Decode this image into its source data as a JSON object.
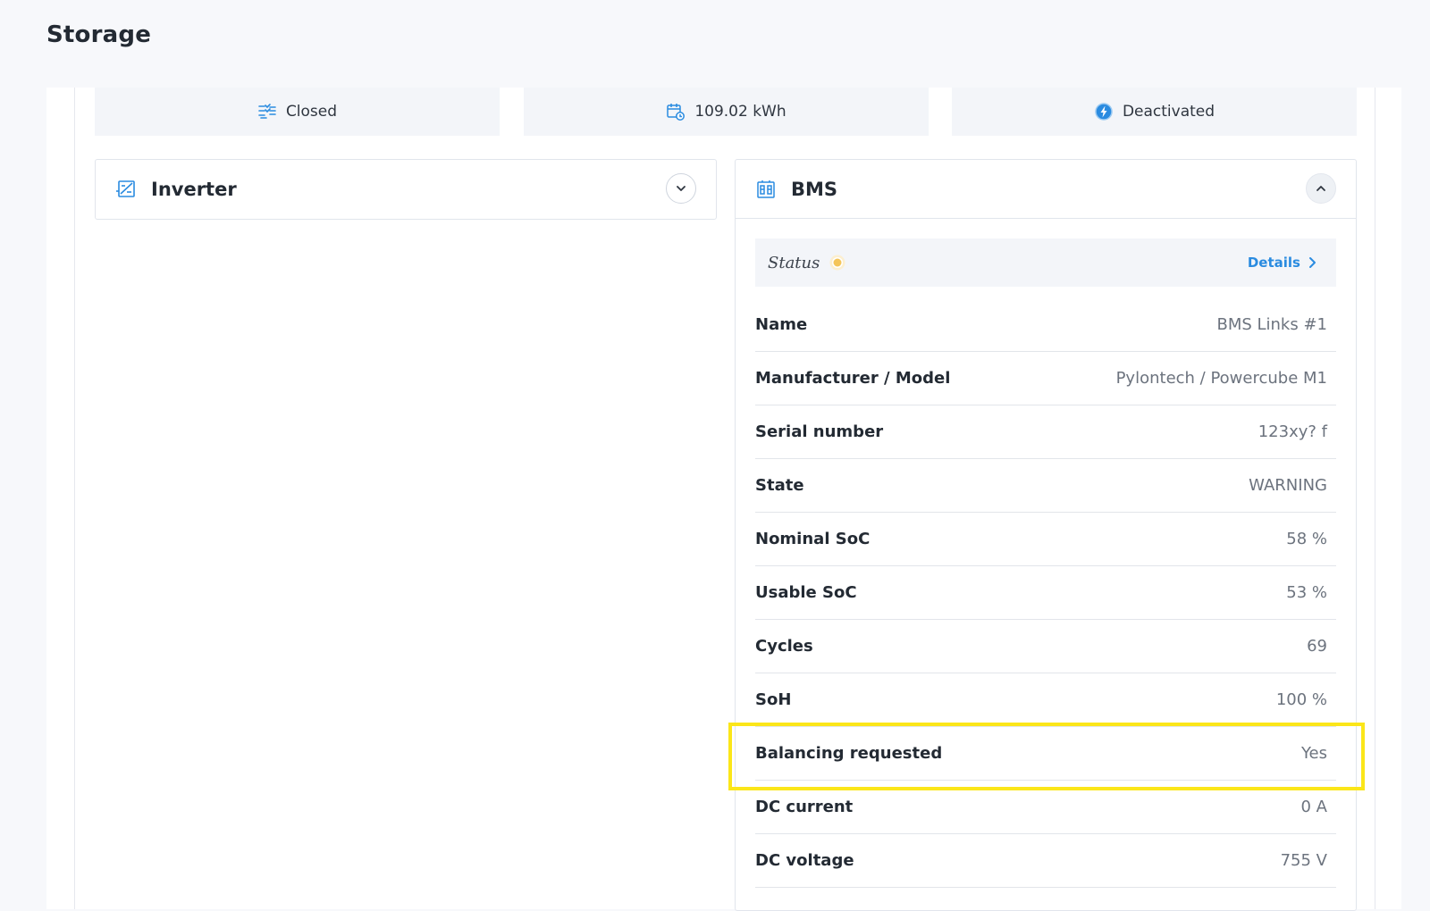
{
  "page": {
    "title": "Storage"
  },
  "summary": [
    {
      "label": "Closed",
      "icon": "list-icon"
    },
    {
      "label": "109.02 kWh",
      "icon": "battery-calendar-icon"
    },
    {
      "label": "Deactivated",
      "icon": "bolt-circle-icon"
    }
  ],
  "inverter": {
    "title": "Inverter",
    "icon": "inverter-icon",
    "toggle": "chevron-down-icon"
  },
  "bms": {
    "title": "BMS",
    "icon": "bms-icon",
    "toggle": "chevron-up-icon",
    "status_label": "Status",
    "details_label": "Details",
    "rows": [
      {
        "k": "Name",
        "v": "BMS Links #1"
      },
      {
        "k": "Manufacturer / Model",
        "v": "Pylontech / Powercube M1"
      },
      {
        "k": "Serial number",
        "v": "123xy? f"
      },
      {
        "k": "State",
        "v": "WARNING"
      },
      {
        "k": "Nominal SoC",
        "v": "58 %"
      },
      {
        "k": "Usable SoC",
        "v": "53 %"
      },
      {
        "k": "Cycles",
        "v": "69"
      },
      {
        "k": "SoH",
        "v": "100 %"
      },
      {
        "k": "Balancing requested",
        "v": "Yes"
      },
      {
        "k": "DC current",
        "v": "0 A"
      },
      {
        "k": "DC voltage",
        "v": "755 V"
      }
    ]
  },
  "colors": {
    "accent": "#2a8be0",
    "status_warning": "#f4c55a",
    "highlight": "#fbe619"
  }
}
